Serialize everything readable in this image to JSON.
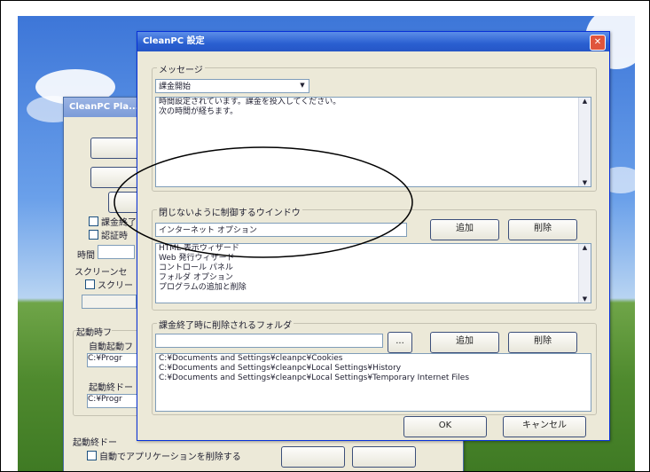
{
  "back_window": {
    "title": "CleanPC Pla...",
    "labels": {
      "time": "時間",
      "screen": "スクリーンセ",
      "startup": "起動時フ",
      "auto_start": "自動起動フ",
      "close_top": "起動終ドー"
    },
    "checkboxes": [
      "課金終了",
      "認証時",
      "スクリー",
      "自動でアプリケーションを削除する"
    ],
    "fields": {
      "path1": "C:¥Progr",
      "path2": "C:¥Progr"
    }
  },
  "dialog": {
    "title": "CleanPC 設定",
    "message_section_label": "メッセージ",
    "message_select_value": "課金開始",
    "message_text_line1": "時間設定されています。課金を投入してください。",
    "message_text_line2": "次の時間が経ちます。",
    "windows_section_label": "閉じないように制御するウインドウ",
    "windows_input_value": "インターネット オプション",
    "add_label": "追加",
    "delete_label": "削除",
    "windows_list": [
      "HTML 表示ウィザード",
      "Web 発行ウィザード",
      "コントロール パネル",
      "フォルダ オプション",
      "プログラムの追加と削除"
    ],
    "folders_section_label": "課金終了時に削除されるフォルダ",
    "browse_label": "...",
    "folders_list": [
      "C:¥Documents and Settings¥cleanpc¥Cookies",
      "C:¥Documents and Settings¥cleanpc¥Local Settings¥History",
      "C:¥Documents and Settings¥cleanpc¥Local Settings¥Temporary Internet Files"
    ],
    "ok_label": "OK",
    "cancel_label": "キャンセル"
  },
  "colors": {
    "annotation_ellipse": "#000000",
    "title_bar": "#2a5fd1",
    "window_face": "#ece9d8"
  },
  "icons": [
    "close-icon",
    "dropdown-arrow-icon",
    "scroll-up-arrow-icon",
    "scroll-down-arrow-icon",
    "checkbox-icon"
  ]
}
